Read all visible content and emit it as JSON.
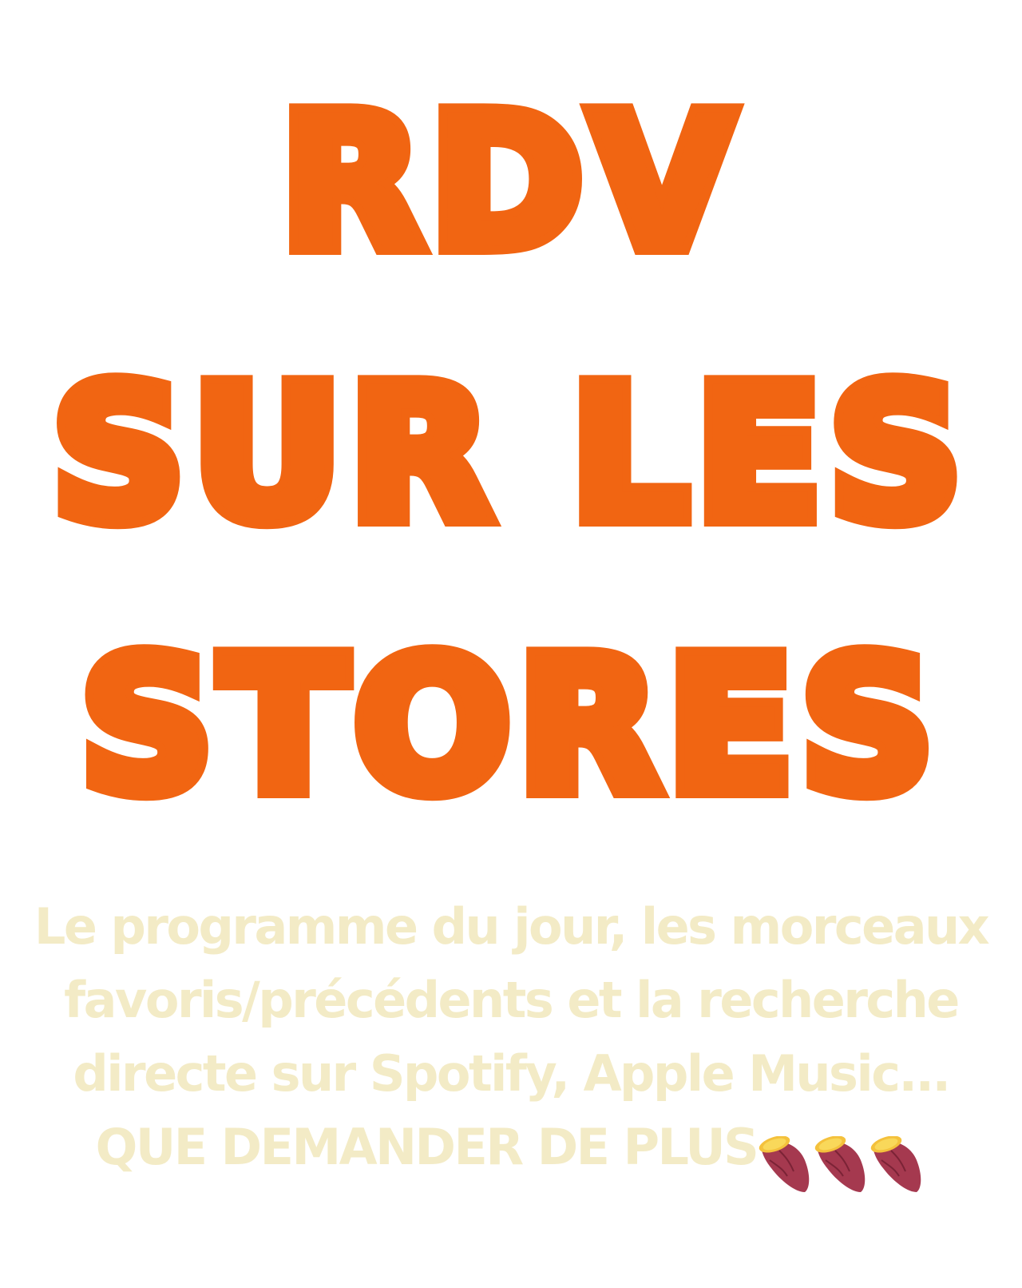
{
  "headline": {
    "line1": "RDV",
    "line2": "SUR LES",
    "line3": "STORES"
  },
  "description": {
    "text": "Le programme du jour, les morceaux favoris/précédents et la recherche directe sur Spotify, Apple Music... QUE DEMANDER DE PLUS",
    "emoji_icons": [
      "sweet-potato-icon",
      "sweet-potato-icon",
      "sweet-potato-icon"
    ]
  },
  "colors": {
    "headline": "#f16512",
    "description": "#f3ebc6",
    "background": "#ffffff"
  }
}
